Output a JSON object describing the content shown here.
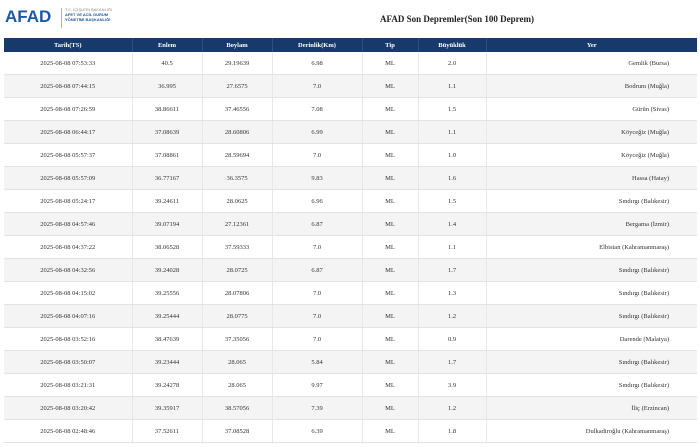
{
  "header": {
    "logo_text": "AFAD",
    "logo_sub_small": "T.C. İÇİŞLERİ BAKANLIĞI",
    "logo_sub_line1": "AFET VE ACİL DURUM",
    "logo_sub_line2": "YÖNETİMİ BAŞKANLIĞI",
    "title": "AFAD Son Depremler(Son 100 Deprem)"
  },
  "colors": {
    "table_header_bg": "#173a6b",
    "logo_blue": "#1c5aa6"
  },
  "table": {
    "columns": [
      "Tarih(TS)",
      "Enlem",
      "Boylam",
      "Derinlik(Km)",
      "Tip",
      "Büyüklük",
      "Yer"
    ],
    "rows": [
      [
        "2025-08-08 07:53:33",
        "40.5",
        "29.19639",
        "6.98",
        "ML",
        "2.0",
        "Gemlik (Bursa)"
      ],
      [
        "2025-08-08 07:44:15",
        "36.995",
        "27.6575",
        "7.0",
        "ML",
        "1.1",
        "Bodrum (Muğla)"
      ],
      [
        "2025-08-08 07:26:59",
        "38.86611",
        "37.46556",
        "7.08",
        "ML",
        "1.5",
        "Gürün (Sivas)"
      ],
      [
        "2025-08-08 06:44:17",
        "37.08639",
        "28.60806",
        "6.99",
        "ML",
        "1.1",
        "Köyceğiz (Muğla)"
      ],
      [
        "2025-08-08 05:57:37",
        "37.08861",
        "28.59694",
        "7.0",
        "ML",
        "1.0",
        "Köyceğiz (Muğla)"
      ],
      [
        "2025-08-08 05:57:09",
        "36.77167",
        "36.3575",
        "9.83",
        "ML",
        "1.6",
        "Hassa (Hatay)"
      ],
      [
        "2025-08-08 05:24:17",
        "39.24611",
        "28.0625",
        "6.96",
        "ML",
        "1.5",
        "Sındırgı (Balıkesir)"
      ],
      [
        "2025-08-08 04:57:46",
        "39.07194",
        "27.12361",
        "6.87",
        "ML",
        "1.4",
        "Bergama (İzmir)"
      ],
      [
        "2025-08-08 04:37:22",
        "38.06528",
        "37.59333",
        "7.0",
        "ML",
        "1.1",
        "Elbistan (Kahramanmaraş)"
      ],
      [
        "2025-08-08 04:32:56",
        "39.24028",
        "28.0725",
        "6.87",
        "ML",
        "1.7",
        "Sındırgı (Balıkesir)"
      ],
      [
        "2025-08-08 04:15:02",
        "39.25556",
        "28.07806",
        "7.0",
        "ML",
        "1.3",
        "Sındırgı (Balıkesir)"
      ],
      [
        "2025-08-08 04:07:16",
        "39.25444",
        "28.0775",
        "7.0",
        "ML",
        "1.2",
        "Sındırgı (Balıkesir)"
      ],
      [
        "2025-08-08 03:52:16",
        "38.47639",
        "37.35056",
        "7.0",
        "ML",
        "0.9",
        "Darende (Malatya)"
      ],
      [
        "2025-08-08 03:50:07",
        "39.23444",
        "28.065",
        "5.84",
        "ML",
        "1.7",
        "Sındırgı (Balıkesir)"
      ],
      [
        "2025-08-08 03:21:31",
        "39.24278",
        "28.065",
        "9.97",
        "ML",
        "3.9",
        "Sındırgı (Balıkesir)"
      ],
      [
        "2025-08-08 03:20:42",
        "39.35917",
        "38.57056",
        "7.39",
        "ML",
        "1.2",
        "İliç (Erzincan)"
      ],
      [
        "2025-08-08 02:48:46",
        "37.52611",
        "37.08528",
        "6.39",
        "ML",
        "1.8",
        "Dulkadiroğlu (Kahramanmaraş)"
      ]
    ]
  }
}
